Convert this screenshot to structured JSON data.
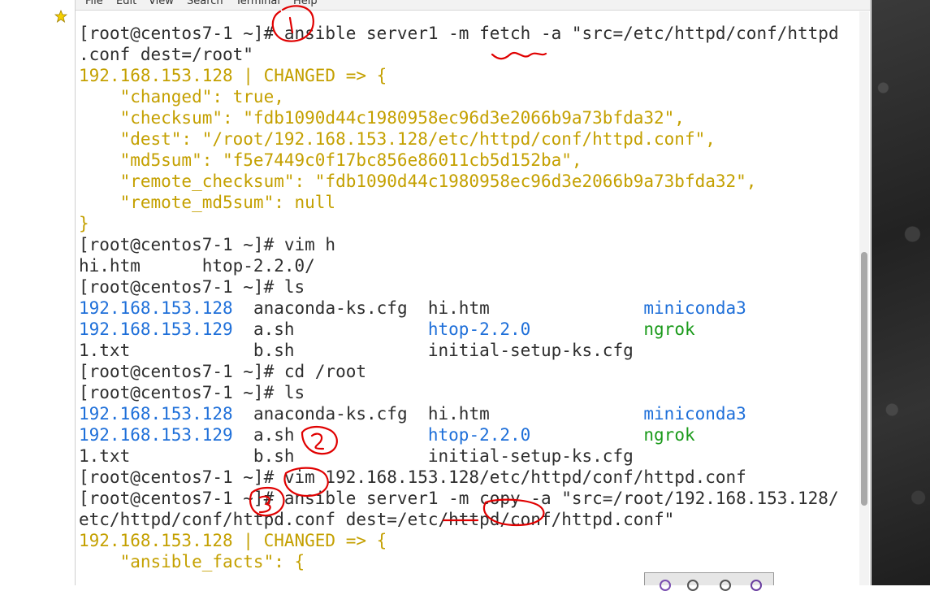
{
  "menubar": {
    "items": [
      "File",
      "Edit",
      "View",
      "Search",
      "Terminal",
      "Help"
    ]
  },
  "terminal": {
    "lines": [
      {
        "segments": [
          {
            "text": "",
            "color": "default"
          }
        ]
      },
      {
        "segments": [
          {
            "text": "[root@centos7-1 ~]# ansible server1 -m fetch -a \"src=/etc/httpd/conf/httpd",
            "color": "default"
          }
        ]
      },
      {
        "segments": [
          {
            "text": ".conf dest=/root\"",
            "color": "default"
          }
        ]
      },
      {
        "segments": [
          {
            "text": "192.168.153.128 | CHANGED => {",
            "color": "yellow"
          }
        ]
      },
      {
        "segments": [
          {
            "text": "    \"changed\": true,",
            "color": "yellow"
          }
        ]
      },
      {
        "segments": [
          {
            "text": "    \"checksum\": \"fdb1090d44c1980958ec96d3e2066b9a73bfda32\",",
            "color": "yellow"
          }
        ]
      },
      {
        "segments": [
          {
            "text": "    \"dest\": \"/root/192.168.153.128/etc/httpd/conf/httpd.conf\",",
            "color": "yellow"
          }
        ]
      },
      {
        "segments": [
          {
            "text": "    \"md5sum\": \"f5e7449c0f17bc856e86011cb5d152ba\",",
            "color": "yellow"
          }
        ]
      },
      {
        "segments": [
          {
            "text": "    \"remote_checksum\": \"fdb1090d44c1980958ec96d3e2066b9a73bfda32\",",
            "color": "yellow"
          }
        ]
      },
      {
        "segments": [
          {
            "text": "    \"remote_md5sum\": null",
            "color": "yellow"
          }
        ]
      },
      {
        "segments": [
          {
            "text": "}",
            "color": "yellow"
          }
        ]
      },
      {
        "segments": [
          {
            "text": "[root@centos7-1 ~]# vim h",
            "color": "default"
          }
        ]
      },
      {
        "segments": [
          {
            "text": "hi.htm      htop-2.2.0/",
            "color": "default"
          }
        ]
      },
      {
        "segments": [
          {
            "text": "[root@centos7-1 ~]# ls",
            "color": "default"
          }
        ]
      },
      {
        "segments": [
          {
            "text": "192.168.153.128",
            "color": "blue"
          },
          {
            "text": "  anaconda-ks.cfg  hi.htm               ",
            "color": "default"
          },
          {
            "text": "miniconda3",
            "color": "blue"
          }
        ]
      },
      {
        "segments": [
          {
            "text": "192.168.153.129",
            "color": "blue"
          },
          {
            "text": "  a.sh             ",
            "color": "default"
          },
          {
            "text": "htop-2.2.0",
            "color": "blue"
          },
          {
            "text": "           ",
            "color": "default"
          },
          {
            "text": "ngrok",
            "color": "green"
          }
        ]
      },
      {
        "segments": [
          {
            "text": "1.txt            b.sh             initial-setup-ks.cfg",
            "color": "default"
          }
        ]
      },
      {
        "segments": [
          {
            "text": "[root@centos7-1 ~]# cd /root",
            "color": "default"
          }
        ]
      },
      {
        "segments": [
          {
            "text": "[root@centos7-1 ~]# ls",
            "color": "default"
          }
        ]
      },
      {
        "segments": [
          {
            "text": "192.168.153.128",
            "color": "blue"
          },
          {
            "text": "  anaconda-ks.cfg  hi.htm               ",
            "color": "default"
          },
          {
            "text": "miniconda3",
            "color": "blue"
          }
        ]
      },
      {
        "segments": [
          {
            "text": "192.168.153.129",
            "color": "blue"
          },
          {
            "text": "  a.sh             ",
            "color": "default"
          },
          {
            "text": "htop-2.2.0",
            "color": "blue"
          },
          {
            "text": "           ",
            "color": "default"
          },
          {
            "text": "ngrok",
            "color": "green"
          }
        ]
      },
      {
        "segments": [
          {
            "text": "1.txt            b.sh             initial-setup-ks.cfg",
            "color": "default"
          }
        ]
      },
      {
        "segments": [
          {
            "text": "[root@centos7-1 ~]# vim 192.168.153.128/etc/httpd/conf/httpd.conf",
            "color": "default"
          }
        ]
      },
      {
        "segments": [
          {
            "text": "[root@centos7-1 ~]# ansible server1 -m copy -a \"src=/root/192.168.153.128/",
            "color": "default"
          }
        ]
      },
      {
        "segments": [
          {
            "text": "etc/httpd/conf/httpd.conf dest=/etc/httpd/conf/httpd.conf\"",
            "color": "default"
          }
        ]
      },
      {
        "segments": [
          {
            "text": "192.168.153.128 | CHANGED => {",
            "color": "yellow"
          }
        ]
      },
      {
        "segments": [
          {
            "text": "    \"ansible_facts\": {",
            "color": "yellow"
          }
        ]
      }
    ]
  },
  "colors": {
    "default": "#2e2e2e",
    "yellow": "#c4a000",
    "blue": "#1e6fd9",
    "green": "#1a9a1a",
    "annotation": "#e00000"
  },
  "icons": {
    "star": "star-icon"
  }
}
